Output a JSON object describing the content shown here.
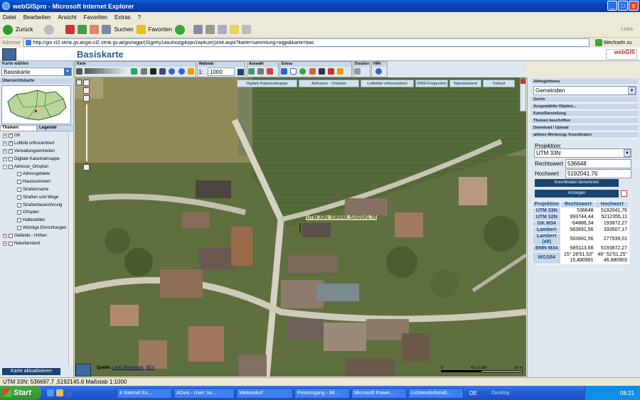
{
  "window": {
    "title": "webGISpro - Microsoft Internet Explorer",
    "min": "_",
    "max": "□",
    "close": "x"
  },
  "menu": [
    "Datei",
    "Bearbeiten",
    "Ansicht",
    "Favoriten",
    "Extras",
    "?"
  ],
  "toolbar": {
    "back": "Zurück",
    "search": "Suchen",
    "favorites": "Favoriten",
    "links": "Links"
  },
  "address": {
    "label": "Adresse",
    "url": "http://gis-cl2.stmk.gv.at/gis-cl2.stmk.gv.at/gis/wgpi/(S(gehy1asuhozgj4zpo1wj4cze))/init.aspx?karte=sammlung+wgpi&karte=bas",
    "go": "Wechseln zu"
  },
  "app": {
    "title": "Basiskarte",
    "logo": "webGIS"
  },
  "left": {
    "karte_waehlen": "Karte wählen",
    "karte_value": "Basiskarte",
    "uebersicht": "Übersichtskarte",
    "tab_themen": "Themen",
    "tab_legende": "Legende",
    "tree": [
      {
        "label": "GK",
        "indent": 0,
        "checked": true,
        "exp": "+"
      },
      {
        "label": "Luftbild orthocentriert",
        "indent": 0,
        "checked": true,
        "exp": "+"
      },
      {
        "label": "Verwaltungseinheiten",
        "indent": 0,
        "checked": true,
        "exp": "+"
      },
      {
        "label": "Digitale Katastralmappe",
        "indent": 0,
        "checked": false,
        "exp": "+"
      },
      {
        "label": "Adresse_Ortsplan",
        "indent": 0,
        "checked": false,
        "exp": "-"
      },
      {
        "label": "Adressgebiete",
        "indent": 1,
        "checked": false
      },
      {
        "label": "Hausnummern",
        "indent": 1,
        "checked": false
      },
      {
        "label": "Straßenname",
        "indent": 1,
        "checked": false
      },
      {
        "label": "Straßen und Wege",
        "indent": 1,
        "checked": false
      },
      {
        "label": "Straßenbezeichnung",
        "indent": 1,
        "checked": false
      },
      {
        "label": "Ortsplan",
        "indent": 1,
        "checked": false
      },
      {
        "label": "Haltestellen",
        "indent": 1,
        "checked": false
      },
      {
        "label": "Wichtige Einrichtungen",
        "indent": 1,
        "checked": false
      },
      {
        "label": "Gelände - Höhen",
        "indent": 0,
        "checked": false,
        "exp": "+"
      },
      {
        "label": "Naturbestand",
        "indent": 0,
        "checked": false,
        "exp": "+"
      }
    ],
    "update_btn": "Karte aktualisieren"
  },
  "groups": {
    "karte": "Karte",
    "massstab": "Maßstab",
    "auswahl": "Auswahl",
    "extras": "Extras",
    "drucken": "Drucken",
    "hilfe": "Hilfe"
  },
  "scale": {
    "prefix": "1:",
    "value": "1000"
  },
  "mapbuttons": [
    "Digitale Katastralmappe",
    "Adressen - Ortsplan",
    "Luftbilder orthocentriert",
    "DKM-Festpunkte",
    "Naturbestand",
    "Default"
  ],
  "map": {
    "coord_label": "UTM 33N: 536648, 5192041.76",
    "quelle_prefix": "Quelle:",
    "quelle_link1": "Land Steiermark",
    "quelle_link2": "BEV",
    "scalebar": "M 1:1.000",
    "scalebar_end": "50 m"
  },
  "right": {
    "abfragethema": "Abfragethema",
    "abfrage_value": "Gemeinden",
    "sections": [
      "Suche",
      "Ausgewählte Objekte...",
      "Karte/Darstellung",
      "Themen beschriften",
      "Download / Upload",
      "aktives Werkzeug: Koordinaten"
    ],
    "projektion_label": "Projektion:",
    "projektion_value": "UTM 33N",
    "rechtswert_label": "Rechtswert",
    "rechtswert_value": "536648",
    "hochwert_label": "Hochwert",
    "hochwert_value": "5192041.76",
    "btn_berechnen": "Koordinaten berechnen",
    "btn_anzeigen": "Anzeigen",
    "table_headers": [
      "Projektion",
      "Rechtswert",
      "Hochwert"
    ],
    "table_rows": [
      [
        "UTM 33N",
        "536648",
        "5192041,76"
      ],
      [
        "UTM 32N",
        "993744,44",
        "5212355,11"
      ],
      [
        "GK M34",
        "-64886,34",
        "193872,27"
      ],
      [
        "Lambert",
        "563691,56",
        "333507,17"
      ],
      [
        "Lambert (alt)",
        "563691,56",
        "277939,01"
      ],
      [
        "BMN M34",
        "685113,66",
        "5193872,27"
      ],
      [
        "WGS84",
        "15° 28'51,53\" 15,480981",
        "46° 52'51,25\" 46,880903"
      ]
    ]
  },
  "status": {
    "text": "UTM 33N: 536697,7 ,5192145,6 Maßstab 1:1000"
  },
  "taskbar": {
    "start": "Start",
    "tasks": [
      "4 Internet Ex...",
      "ADvis - User: ko...",
      "Weitendorf",
      "Posteingang - Mi...",
      "Microsoft Power...",
      "Lichtendorfstraß..."
    ],
    "lang": "DE",
    "desktop": "Desktop",
    "time": "08:21"
  }
}
